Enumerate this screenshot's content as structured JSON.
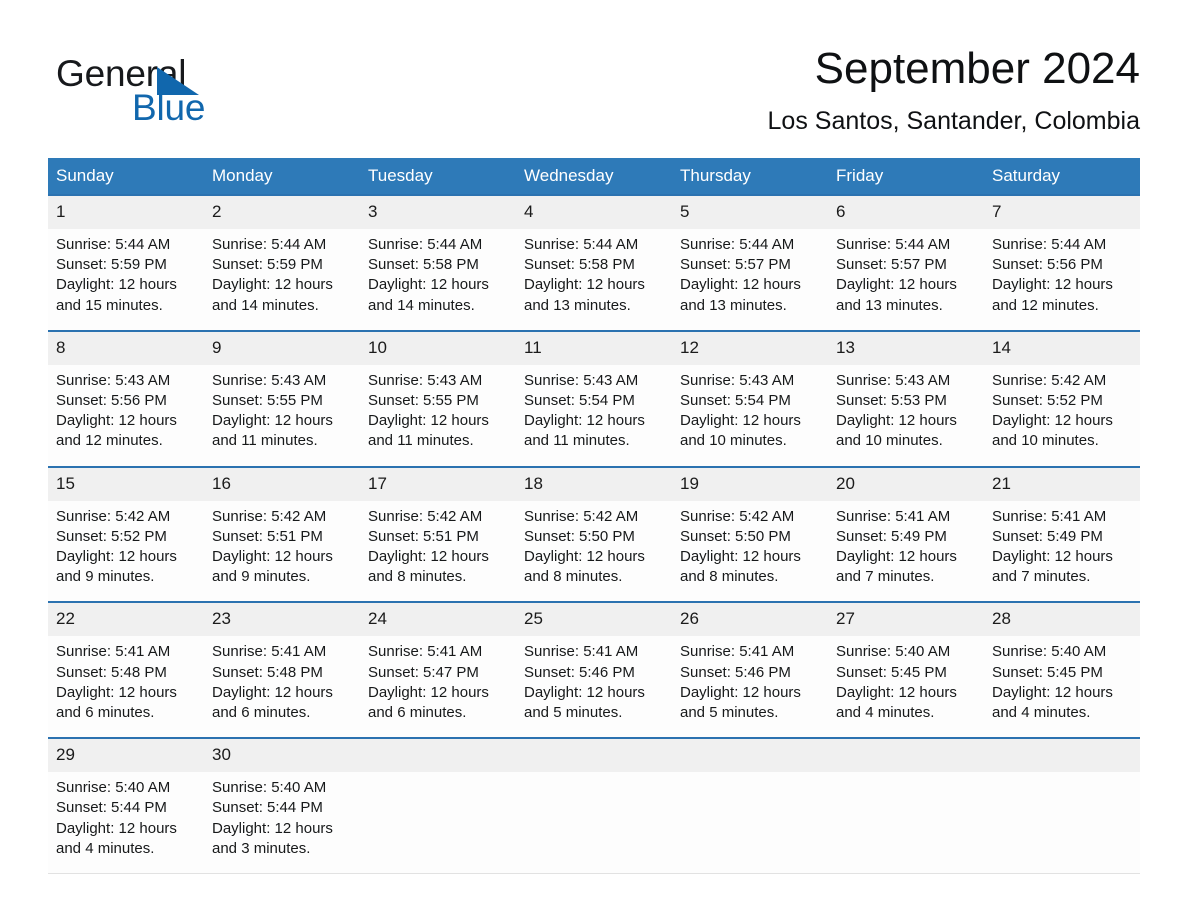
{
  "brand": {
    "name_part1": "General",
    "name_part2": "Blue",
    "triangle_color": "#1167ad",
    "text_color": "#17191c"
  },
  "header": {
    "title": "September 2024",
    "subtitle": "Los Santos, Santander, Colombia"
  },
  "theme": {
    "header_blue": "#2e7ab8",
    "separator_blue": "#2b72b0",
    "daynum_band": "#f0f0f0",
    "cell_bg": "#fdfdfd"
  },
  "calendar": {
    "weekday_headers": [
      "Sunday",
      "Monday",
      "Tuesday",
      "Wednesday",
      "Thursday",
      "Friday",
      "Saturday"
    ],
    "weeks": [
      [
        {
          "day": "1",
          "lines": [
            "Sunrise: 5:44 AM",
            "Sunset: 5:59 PM",
            "Daylight: 12 hours",
            "and 15 minutes."
          ]
        },
        {
          "day": "2",
          "lines": [
            "Sunrise: 5:44 AM",
            "Sunset: 5:59 PM",
            "Daylight: 12 hours",
            "and 14 minutes."
          ]
        },
        {
          "day": "3",
          "lines": [
            "Sunrise: 5:44 AM",
            "Sunset: 5:58 PM",
            "Daylight: 12 hours",
            "and 14 minutes."
          ]
        },
        {
          "day": "4",
          "lines": [
            "Sunrise: 5:44 AM",
            "Sunset: 5:58 PM",
            "Daylight: 12 hours",
            "and 13 minutes."
          ]
        },
        {
          "day": "5",
          "lines": [
            "Sunrise: 5:44 AM",
            "Sunset: 5:57 PM",
            "Daylight: 12 hours",
            "and 13 minutes."
          ]
        },
        {
          "day": "6",
          "lines": [
            "Sunrise: 5:44 AM",
            "Sunset: 5:57 PM",
            "Daylight: 12 hours",
            "and 13 minutes."
          ]
        },
        {
          "day": "7",
          "lines": [
            "Sunrise: 5:44 AM",
            "Sunset: 5:56 PM",
            "Daylight: 12 hours",
            "and 12 minutes."
          ]
        }
      ],
      [
        {
          "day": "8",
          "lines": [
            "Sunrise: 5:43 AM",
            "Sunset: 5:56 PM",
            "Daylight: 12 hours",
            "and 12 minutes."
          ]
        },
        {
          "day": "9",
          "lines": [
            "Sunrise: 5:43 AM",
            "Sunset: 5:55 PM",
            "Daylight: 12 hours",
            "and 11 minutes."
          ]
        },
        {
          "day": "10",
          "lines": [
            "Sunrise: 5:43 AM",
            "Sunset: 5:55 PM",
            "Daylight: 12 hours",
            "and 11 minutes."
          ]
        },
        {
          "day": "11",
          "lines": [
            "Sunrise: 5:43 AM",
            "Sunset: 5:54 PM",
            "Daylight: 12 hours",
            "and 11 minutes."
          ]
        },
        {
          "day": "12",
          "lines": [
            "Sunrise: 5:43 AM",
            "Sunset: 5:54 PM",
            "Daylight: 12 hours",
            "and 10 minutes."
          ]
        },
        {
          "day": "13",
          "lines": [
            "Sunrise: 5:43 AM",
            "Sunset: 5:53 PM",
            "Daylight: 12 hours",
            "and 10 minutes."
          ]
        },
        {
          "day": "14",
          "lines": [
            "Sunrise: 5:42 AM",
            "Sunset: 5:52 PM",
            "Daylight: 12 hours",
            "and 10 minutes."
          ]
        }
      ],
      [
        {
          "day": "15",
          "lines": [
            "Sunrise: 5:42 AM",
            "Sunset: 5:52 PM",
            "Daylight: 12 hours",
            "and 9 minutes."
          ]
        },
        {
          "day": "16",
          "lines": [
            "Sunrise: 5:42 AM",
            "Sunset: 5:51 PM",
            "Daylight: 12 hours",
            "and 9 minutes."
          ]
        },
        {
          "day": "17",
          "lines": [
            "Sunrise: 5:42 AM",
            "Sunset: 5:51 PM",
            "Daylight: 12 hours",
            "and 8 minutes."
          ]
        },
        {
          "day": "18",
          "lines": [
            "Sunrise: 5:42 AM",
            "Sunset: 5:50 PM",
            "Daylight: 12 hours",
            "and 8 minutes."
          ]
        },
        {
          "day": "19",
          "lines": [
            "Sunrise: 5:42 AM",
            "Sunset: 5:50 PM",
            "Daylight: 12 hours",
            "and 8 minutes."
          ]
        },
        {
          "day": "20",
          "lines": [
            "Sunrise: 5:41 AM",
            "Sunset: 5:49 PM",
            "Daylight: 12 hours",
            "and 7 minutes."
          ]
        },
        {
          "day": "21",
          "lines": [
            "Sunrise: 5:41 AM",
            "Sunset: 5:49 PM",
            "Daylight: 12 hours",
            "and 7 minutes."
          ]
        }
      ],
      [
        {
          "day": "22",
          "lines": [
            "Sunrise: 5:41 AM",
            "Sunset: 5:48 PM",
            "Daylight: 12 hours",
            "and 6 minutes."
          ]
        },
        {
          "day": "23",
          "lines": [
            "Sunrise: 5:41 AM",
            "Sunset: 5:48 PM",
            "Daylight: 12 hours",
            "and 6 minutes."
          ]
        },
        {
          "day": "24",
          "lines": [
            "Sunrise: 5:41 AM",
            "Sunset: 5:47 PM",
            "Daylight: 12 hours",
            "and 6 minutes."
          ]
        },
        {
          "day": "25",
          "lines": [
            "Sunrise: 5:41 AM",
            "Sunset: 5:46 PM",
            "Daylight: 12 hours",
            "and 5 minutes."
          ]
        },
        {
          "day": "26",
          "lines": [
            "Sunrise: 5:41 AM",
            "Sunset: 5:46 PM",
            "Daylight: 12 hours",
            "and 5 minutes."
          ]
        },
        {
          "day": "27",
          "lines": [
            "Sunrise: 5:40 AM",
            "Sunset: 5:45 PM",
            "Daylight: 12 hours",
            "and 4 minutes."
          ]
        },
        {
          "day": "28",
          "lines": [
            "Sunrise: 5:40 AM",
            "Sunset: 5:45 PM",
            "Daylight: 12 hours",
            "and 4 minutes."
          ]
        }
      ],
      [
        {
          "day": "29",
          "lines": [
            "Sunrise: 5:40 AM",
            "Sunset: 5:44 PM",
            "Daylight: 12 hours",
            "and 4 minutes."
          ]
        },
        {
          "day": "30",
          "lines": [
            "Sunrise: 5:40 AM",
            "Sunset: 5:44 PM",
            "Daylight: 12 hours",
            "and 3 minutes."
          ]
        },
        {
          "day": "",
          "lines": []
        },
        {
          "day": "",
          "lines": []
        },
        {
          "day": "",
          "lines": []
        },
        {
          "day": "",
          "lines": []
        },
        {
          "day": "",
          "lines": []
        }
      ]
    ]
  }
}
